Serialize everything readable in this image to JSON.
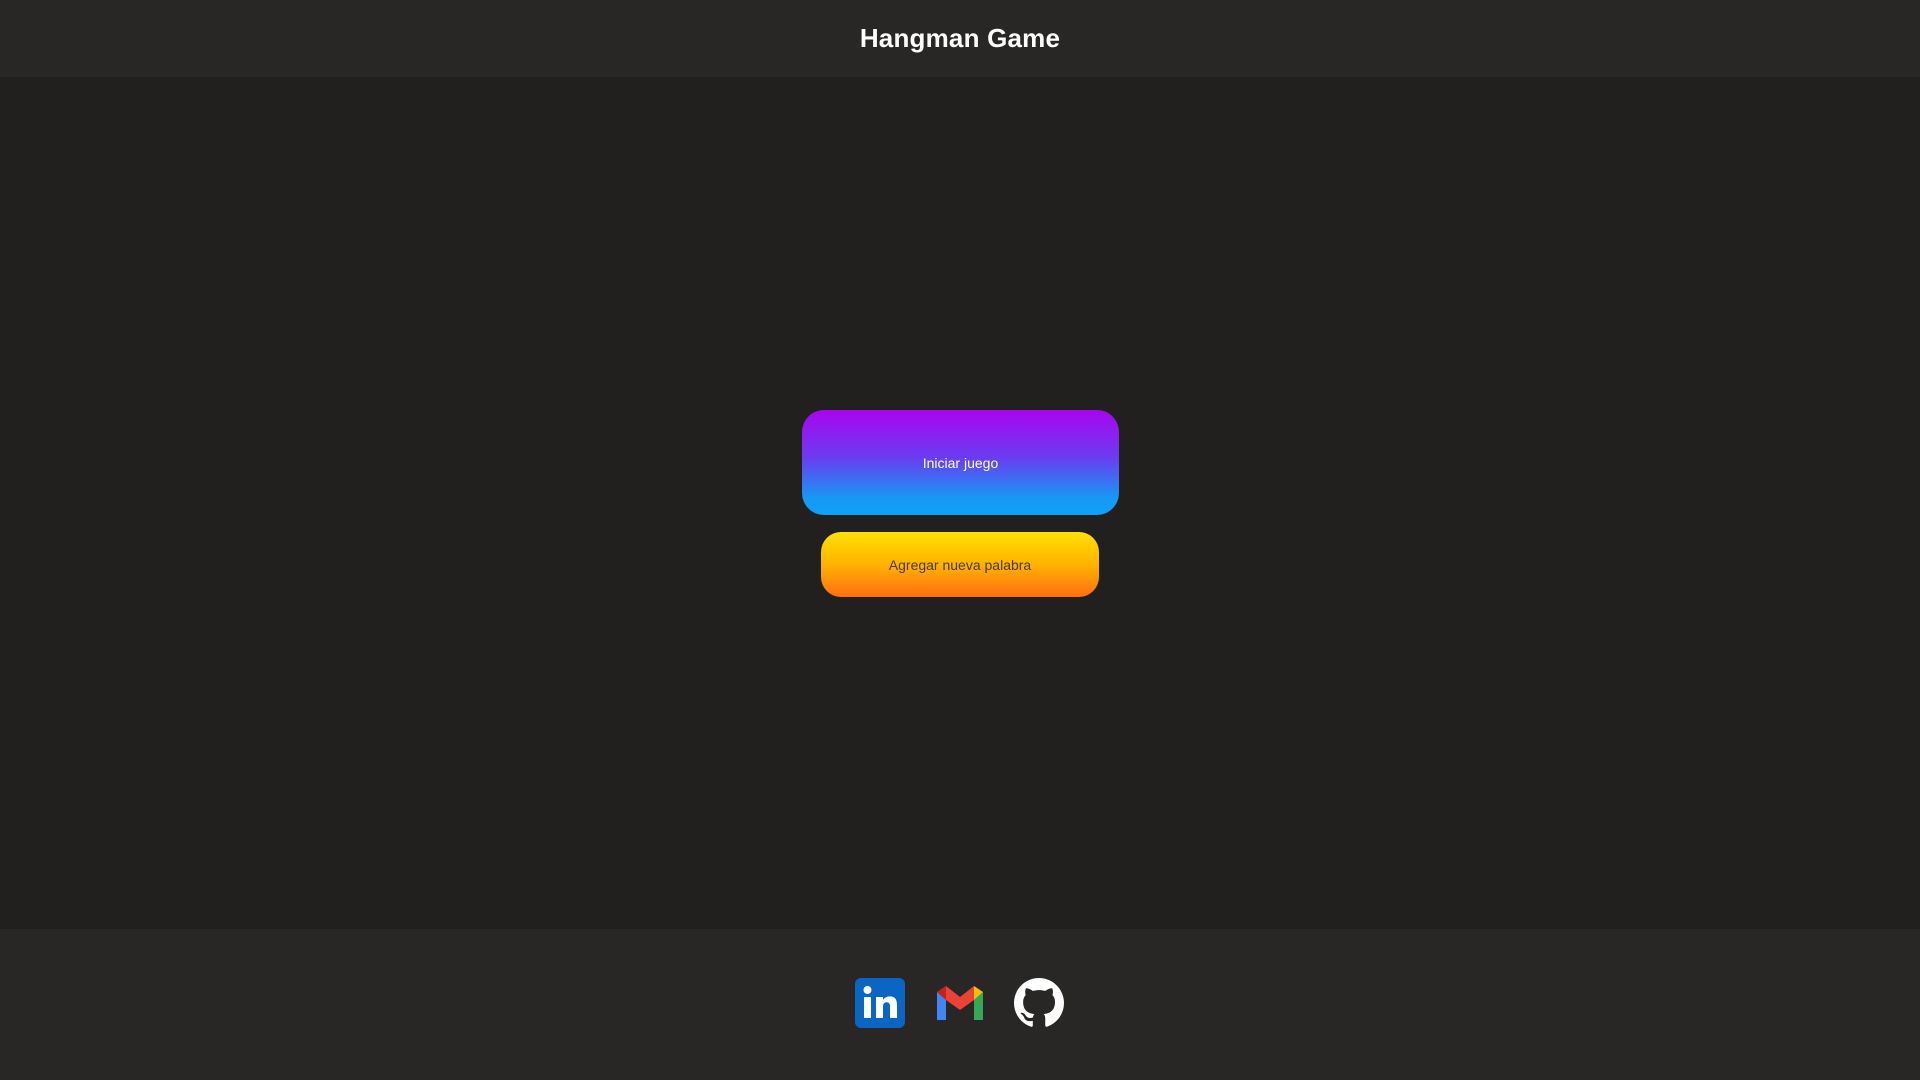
{
  "header": {
    "title": "Hangman Game"
  },
  "main": {
    "start_button_label": "Iniciar juego",
    "add_word_button_label": "Agregar nueva palabra"
  },
  "footer": {
    "links": [
      {
        "icon": "linkedin-icon",
        "color": "#0a66c2"
      },
      {
        "icon": "gmail-icon",
        "color": "#ea4335"
      },
      {
        "icon": "github-icon",
        "color": "#ffffff"
      }
    ]
  },
  "colors": {
    "background": "#21201e",
    "header_background": "#282725",
    "start_gradient_top": "#a805ef",
    "start_gradient_bottom": "#0fa0f6",
    "add_gradient_top": "#ffe000",
    "add_gradient_bottom": "#ff6e12"
  }
}
